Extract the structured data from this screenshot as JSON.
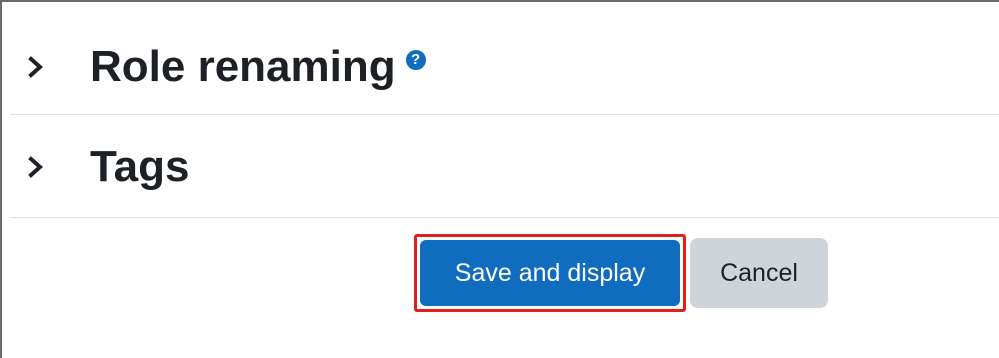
{
  "sections": [
    {
      "title": "Role renaming",
      "has_help": true,
      "help_glyph": "?",
      "expanded": false,
      "icon": "chevron-right-icon"
    },
    {
      "title": "Tags",
      "has_help": false,
      "expanded": false,
      "icon": "chevron-right-icon"
    }
  ],
  "actions": {
    "save_label": "Save and display",
    "cancel_label": "Cancel"
  },
  "colors": {
    "primary": "#0f6cbf",
    "secondary": "#ced4da",
    "highlight": "#e0201b",
    "text": "#1d2125"
  }
}
